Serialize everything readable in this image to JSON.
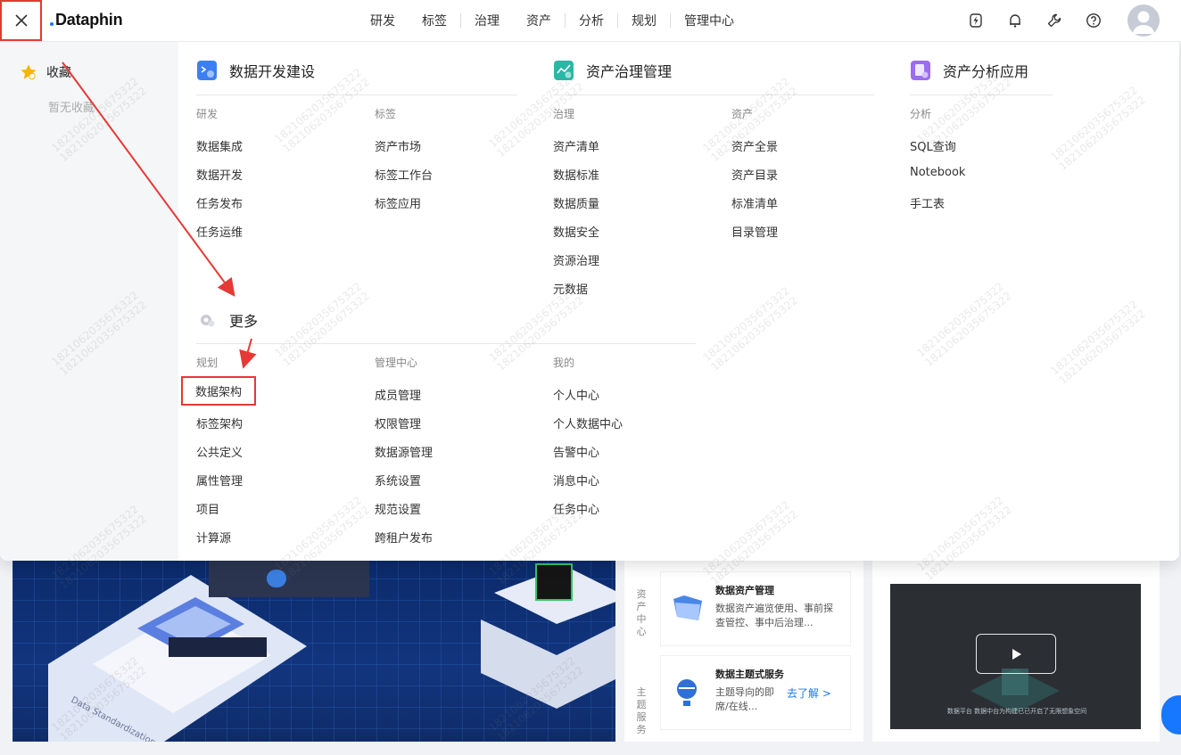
{
  "app": {
    "logo": "Dataphin"
  },
  "topnav": {
    "items": [
      "研发",
      "标签",
      "治理",
      "资产",
      "分析",
      "规划",
      "管理中心"
    ]
  },
  "favorites": {
    "label": "收藏",
    "empty": "暂无收藏"
  },
  "sections": {
    "dev": {
      "title": "数据开发建设",
      "groups": [
        {
          "title": "研发",
          "items": [
            "数据集成",
            "数据开发",
            "任务发布",
            "任务运维"
          ]
        },
        {
          "title": "标签",
          "items": [
            "资产市场",
            "标签工作台",
            "标签应用"
          ]
        }
      ]
    },
    "gov": {
      "title": "资产治理管理",
      "groups": [
        {
          "title": "治理",
          "items": [
            "资产清单",
            "数据标准",
            "数据质量",
            "数据安全",
            "资源治理",
            "元数据"
          ]
        },
        {
          "title": "资产",
          "items": [
            "资产全景",
            "资产目录",
            "标准清单",
            "目录管理"
          ]
        }
      ]
    },
    "ana": {
      "title": "资产分析应用",
      "groups": [
        {
          "title": "分析",
          "items": [
            "SQL查询",
            "Notebook",
            "手工表"
          ]
        }
      ]
    },
    "more": {
      "title": "更多",
      "groups": [
        {
          "title": "规划",
          "items": [
            "数据架构",
            "标签架构",
            "公共定义",
            "属性管理",
            "项目",
            "计算源"
          ]
        },
        {
          "title": "管理中心",
          "items": [
            "成员管理",
            "权限管理",
            "数据源管理",
            "系统设置",
            "规范设置",
            "跨租户发布"
          ]
        },
        {
          "title": "我的",
          "items": [
            "个人中心",
            "个人数据中心",
            "告警中心",
            "消息中心",
            "任务中心"
          ]
        }
      ]
    }
  },
  "background": {
    "banner_text": "Data Standardization",
    "side_labels": [
      "资产中心",
      "主题服务"
    ],
    "cards": [
      {
        "title": "数据资产管理",
        "desc": "数据资产遍览使用、事前探查管控、事中后治理..."
      },
      {
        "title": "数据主题式服务",
        "desc": "主题导向的即席/在线...",
        "link": "去了解 >"
      }
    ],
    "video_caption": "数据平台\n数据中台为构建已已开启了无限想象空间"
  },
  "watermark": "1821062035675322",
  "colors": {
    "accent": "#1677ff",
    "highlight": "#e53935"
  }
}
